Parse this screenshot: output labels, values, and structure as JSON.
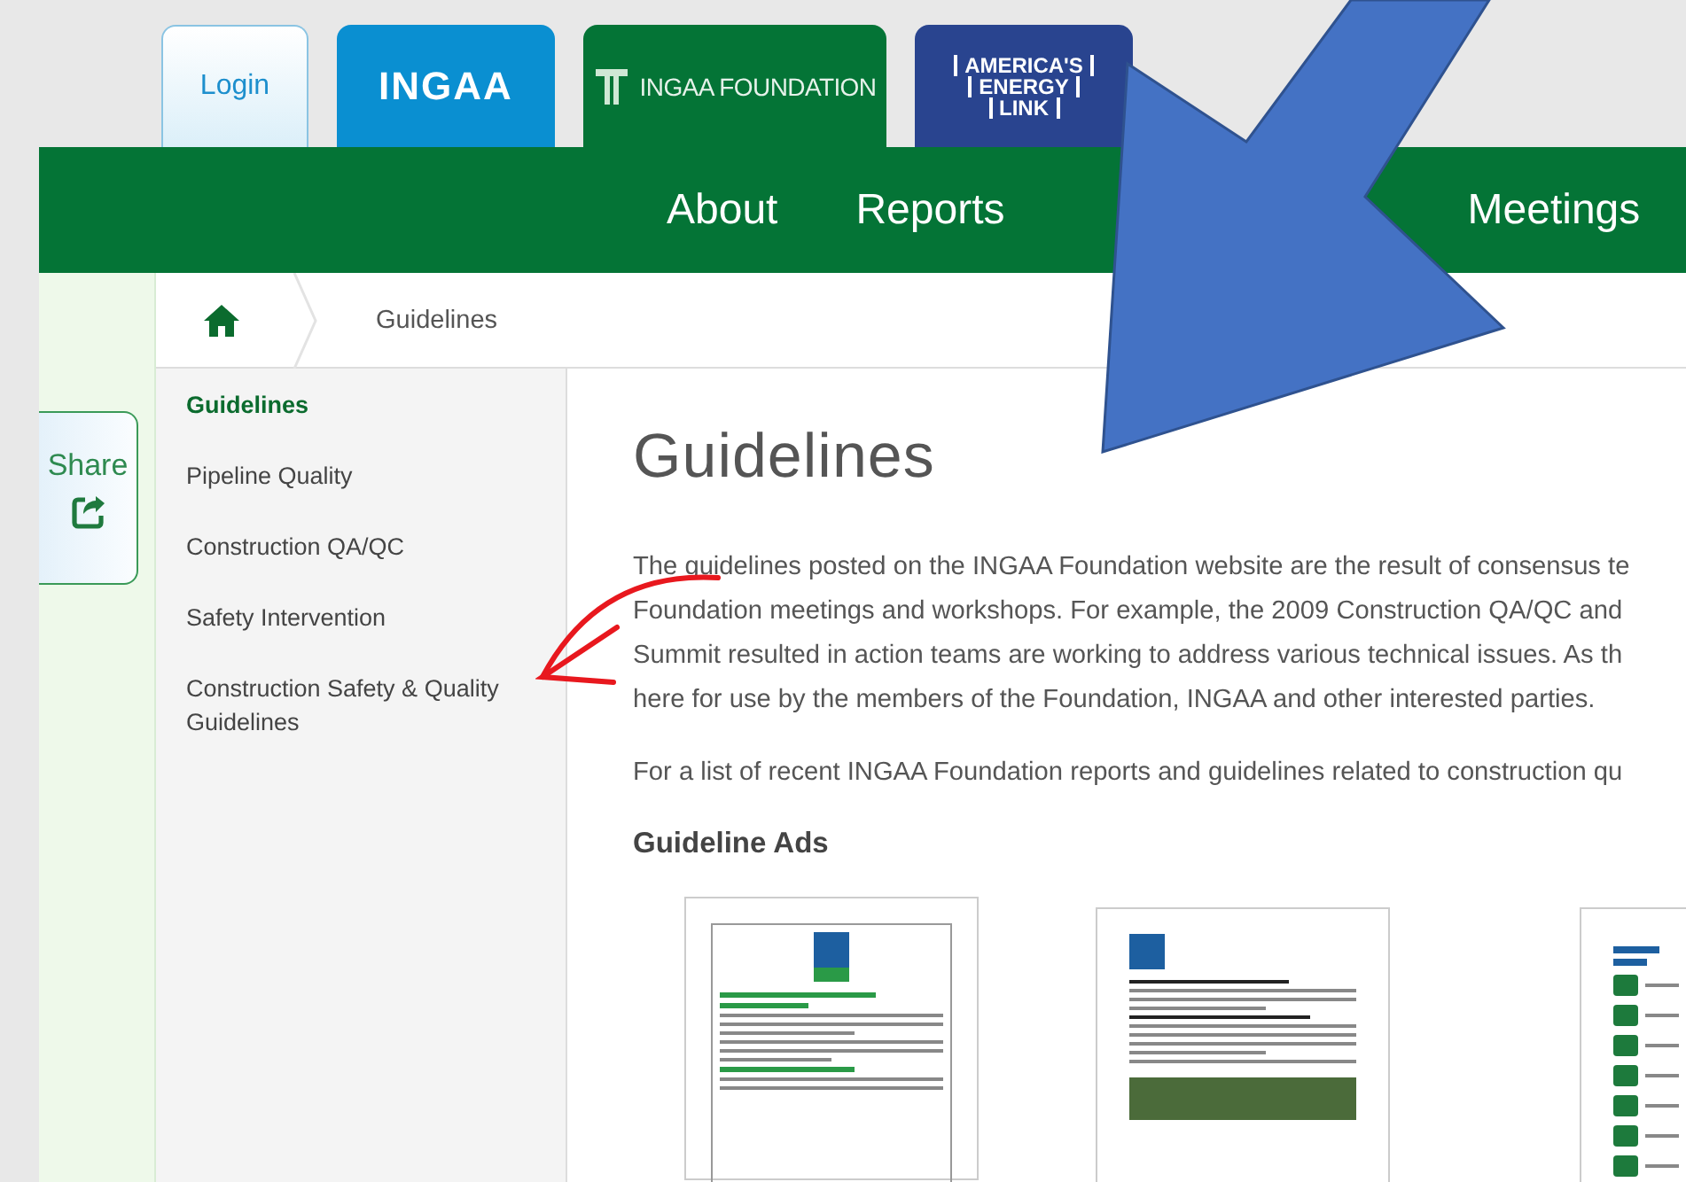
{
  "header_tabs": [
    {
      "kind": "login",
      "label": "Login"
    },
    {
      "kind": "ingaa",
      "label": "INGAA"
    },
    {
      "kind": "foundation",
      "label": "INGAA FOUNDATION"
    },
    {
      "kind": "energy_link",
      "lines": [
        "AMERICA'S",
        "ENERGY",
        "LINK"
      ]
    }
  ],
  "nav": {
    "items": [
      "About",
      "Reports",
      "Meetings"
    ]
  },
  "share": {
    "label": "Share"
  },
  "breadcrumb": {
    "current": "Guidelines"
  },
  "sidebar": {
    "items": [
      {
        "label": "Guidelines",
        "selected": true
      },
      {
        "label": "Pipeline Quality",
        "selected": false
      },
      {
        "label": "Construction QA/QC",
        "selected": false
      },
      {
        "label": "Safety Intervention",
        "selected": false
      },
      {
        "label": "Construction Safety & Quality Guidelines",
        "selected": false
      }
    ]
  },
  "main": {
    "title": "Guidelines",
    "paragraphs": [
      [
        "The guidelines posted on the INGAA Foundation website are the result of consensus te",
        "Foundation meetings and workshops. For example, the 2009 Construction QA/QC and",
        "Summit resulted in action teams are working to address various technical issues. As th",
        "here for use by the members of the Foundation, INGAA and other interested parties."
      ],
      [
        "For a list of recent INGAA Foundation reports and guidelines related to construction qu"
      ]
    ],
    "section_title": "Guideline Ads"
  }
}
